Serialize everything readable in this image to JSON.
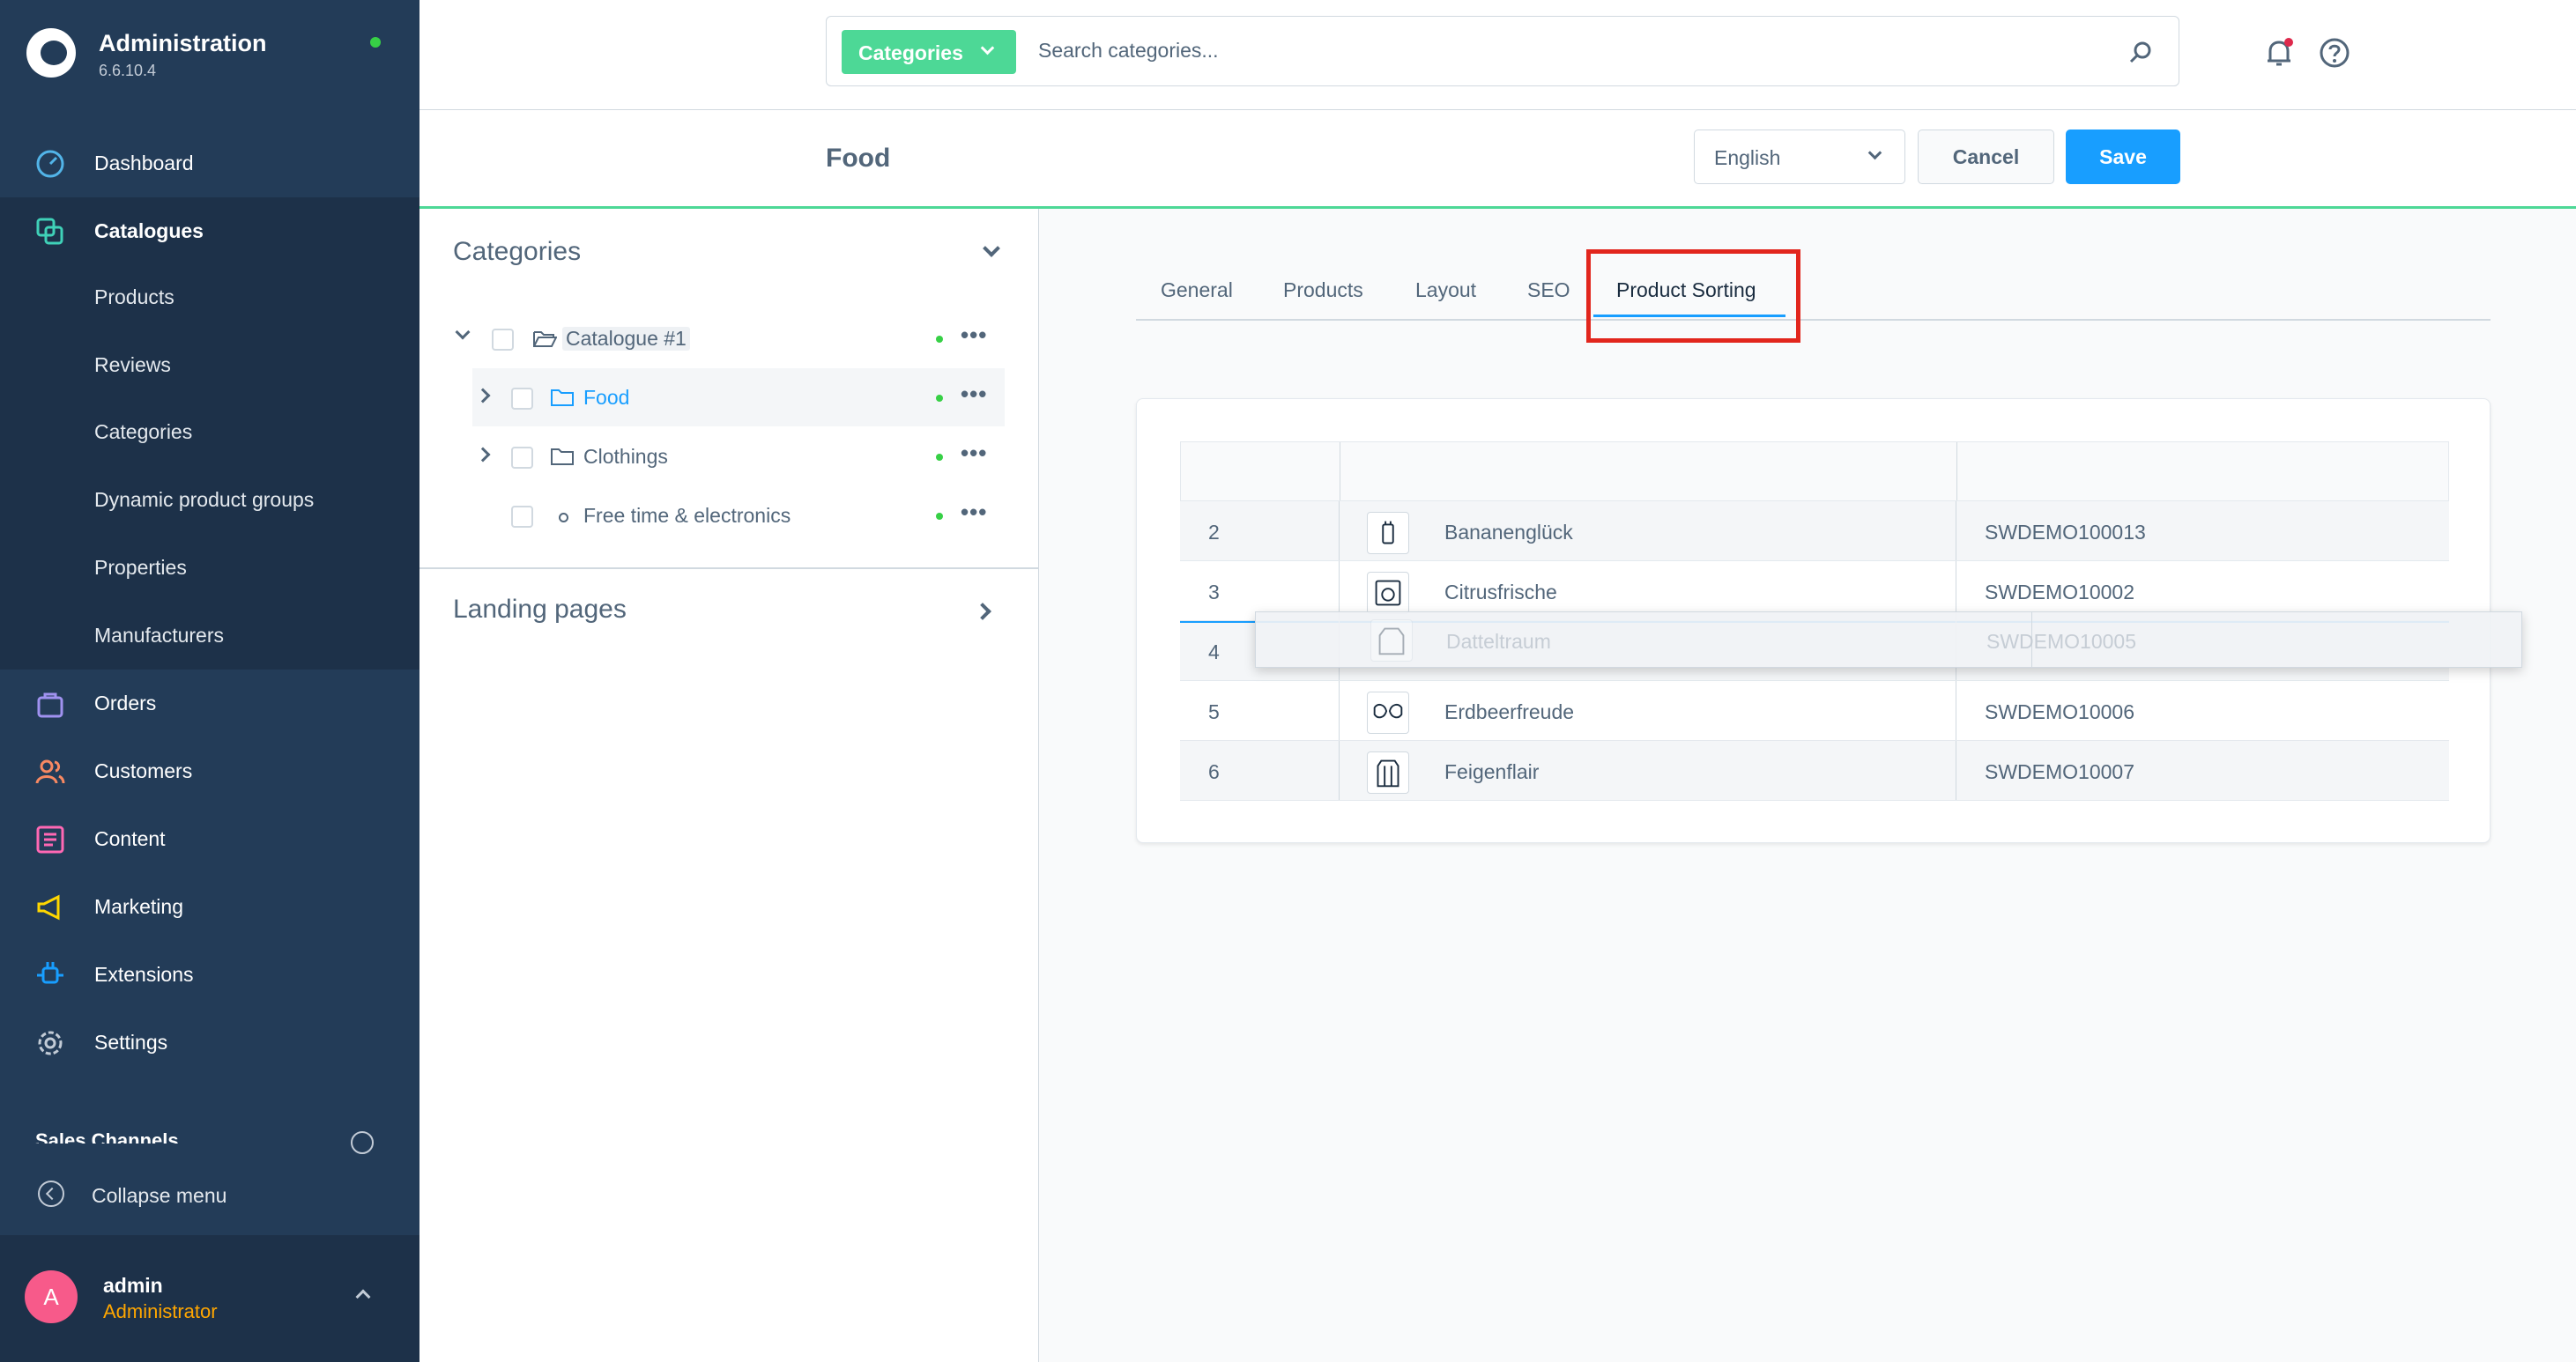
{
  "app": {
    "title": "Administration",
    "version": "6.6.10.4"
  },
  "nav": {
    "dashboard": "Dashboard",
    "catalogues": "Catalogues",
    "catalogue_sub": [
      "Products",
      "Reviews",
      "Categories",
      "Dynamic product groups",
      "Properties",
      "Manufacturers"
    ],
    "orders": "Orders",
    "customers": "Customers",
    "content": "Content",
    "marketing": "Marketing",
    "extensions": "Extensions",
    "settings": "Settings",
    "sales_channels": "Sales Channels",
    "collapse": "Collapse menu"
  },
  "user": {
    "initial": "A",
    "name": "admin",
    "role": "Administrator"
  },
  "search": {
    "type_label": "Categories",
    "placeholder": "Search categories..."
  },
  "smartbar": {
    "title": "Food",
    "language": "English",
    "cancel": "Cancel",
    "save": "Save"
  },
  "tree": {
    "heading": "Categories",
    "items": [
      {
        "label": "Catalogue #1"
      },
      {
        "label": "Food"
      },
      {
        "label": "Clothings"
      },
      {
        "label": "Free time & electronics"
      }
    ],
    "more": "•••",
    "landing_pages": "Landing pages"
  },
  "tabs": [
    "General",
    "Products",
    "Layout",
    "SEO",
    "Product Sorting"
  ],
  "sorting": {
    "rows": [
      {
        "pos": "2",
        "name": "Bananenglück",
        "number": "SWDEMO100013"
      },
      {
        "pos": "3",
        "name": "Citrusfrische",
        "number": "SWDEMO10002"
      },
      {
        "pos": "4",
        "name": "Datteltraum",
        "number": "SWDEMO10005"
      },
      {
        "pos": "5",
        "name": "Erdbeerfreude",
        "number": "SWDEMO10006"
      },
      {
        "pos": "6",
        "name": "Feigenflair",
        "number": "SWDEMO10007"
      }
    ]
  },
  "colors": {
    "sidebar": "#233c58",
    "accent": "#189eff",
    "brand_green": "#4dd896",
    "highlight": "#e2261d"
  }
}
